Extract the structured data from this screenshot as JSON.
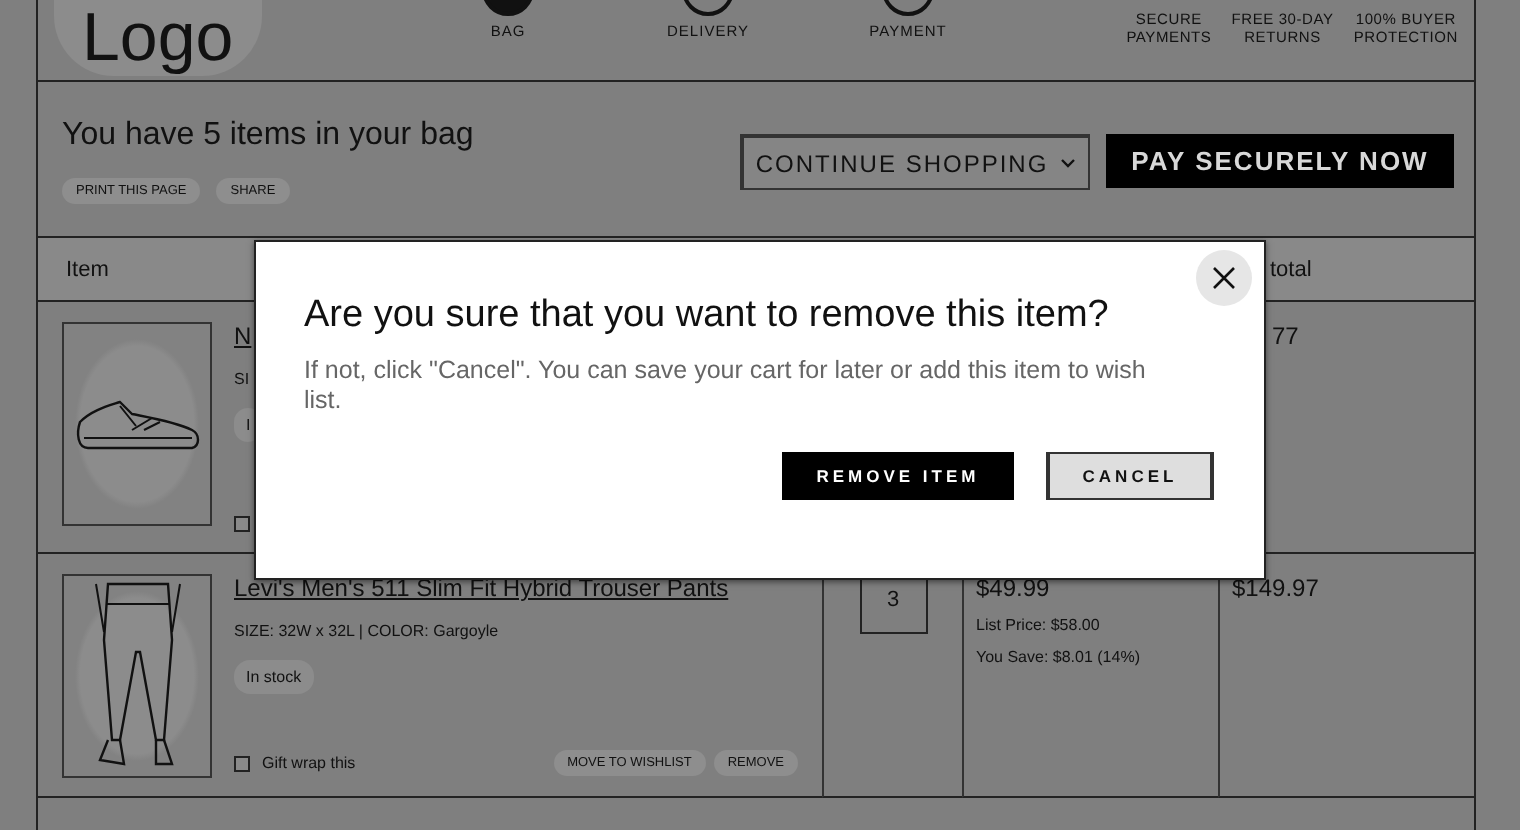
{
  "logo": "Logo",
  "steps": [
    {
      "label": "BAG",
      "selected": true
    },
    {
      "label": "DELIVERY",
      "selected": false
    },
    {
      "label": "PAYMENT",
      "selected": false
    }
  ],
  "assurances": [
    "SECURE\nPAYMENTS",
    "FREE 30-DAY\nRETURNS",
    "100% BUYER\nPROTECTION"
  ],
  "cart": {
    "summary": "You have 5 items in your bag",
    "actions": [
      "PRINT THIS PAGE",
      "SHARE"
    ],
    "continue": "CONTINUE SHOPPING",
    "pay": "PAY SECURELY NOW"
  },
  "table": {
    "columns": [
      "Item",
      "total"
    ],
    "rows": [
      {
        "kind": "sneaker",
        "name": "N",
        "spec": "SI",
        "stock": "I",
        "gift_wrap": {
          "checked": false
        },
        "subtotal": "77"
      },
      {
        "kind": "trousers",
        "name": "Levi's Men's 511 Slim Fit Hybrid Trouser Pants",
        "spec": "SIZE: 32W x 32L  |  COLOR: Gargoyle",
        "stock": "In stock",
        "gift_wrap": {
          "label": "Gift wrap this",
          "checked": false
        },
        "actions": [
          "MOVE TO WISHLIST",
          "REMOVE"
        ],
        "quantity": "3",
        "price": "$49.99",
        "list_price": "List Price: $58.00",
        "savings": "You Save: $8.01 (14%)",
        "subtotal": "$149.97"
      }
    ]
  },
  "dialog": {
    "title": "Are you sure that you want to remove this item?",
    "message": "If not, click \"Cancel\". You can save your cart for later or add this item to wish list.",
    "buttons": [
      {
        "label": "REMOVE ITEM",
        "kind": "primary"
      },
      {
        "label": "CANCEL",
        "kind": "secondary"
      }
    ]
  }
}
